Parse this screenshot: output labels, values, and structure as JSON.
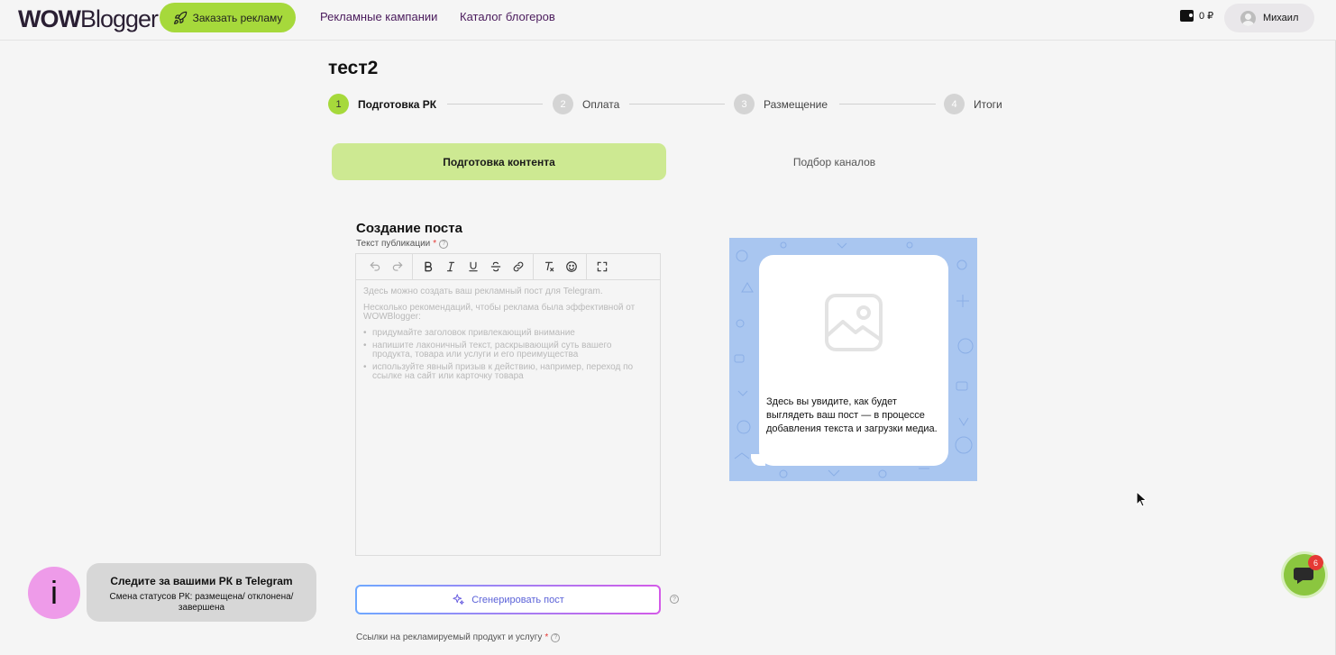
{
  "header": {
    "logo_wow": "WOW",
    "logo_blogger": "Blogger",
    "order_button": "Заказать рекламу",
    "nav": [
      "Рекламные кампании",
      "Каталог блогеров"
    ],
    "balance": "0 ₽",
    "user_name": "Михаил"
  },
  "page": {
    "title": "тест2",
    "steps": [
      {
        "num": "1",
        "label": "Подготовка РК",
        "active": true
      },
      {
        "num": "2",
        "label": "Оплата",
        "active": false
      },
      {
        "num": "3",
        "label": "Размещение",
        "active": false
      },
      {
        "num": "4",
        "label": "Итоги",
        "active": false
      }
    ],
    "tabs": {
      "active": "Подготовка контента",
      "inactive": "Подбор каналов"
    }
  },
  "post": {
    "section_title": "Создание поста",
    "text_label": "Текст публикации",
    "required_mark": "*",
    "help_mark": "?",
    "placeholder_intro": "Здесь можно создать ваш рекламный пост для Telegram.",
    "placeholder_reco": "Несколько рекомендаций, чтобы реклама была эффективной от WOWBlogger:",
    "placeholder_bullets": [
      "придумайте заголовок привлекающий внимание",
      "напишите лаконичный текст, раскрывающий суть вашего продукта, товара или услуги и его преимущества",
      "используйте явный призыв к действию, например, переход по ссылке на сайт или карточку товара"
    ],
    "generate_button": "Сгенерировать пост",
    "links_label": "Ссылки на рекламируемый продукт и услугу"
  },
  "preview": {
    "text": "Здесь вы увидите, как будет выглядеть ваш пост — в процессе добавления текста и загрузки медиа."
  },
  "telegram_notice": {
    "icon_letter": "i",
    "title": "Следите за вашими РК в Telegram",
    "text": "Смена статусов РК: размещена/ отклонена/завершена"
  },
  "chat": {
    "badge": "6"
  },
  "colors": {
    "accent_green": "#a6d93b",
    "tab_green": "#cde992",
    "nav_purple": "#4a1b5c",
    "preview_blue": "#a9c6f0",
    "notice_pink": "#ee9be9"
  }
}
